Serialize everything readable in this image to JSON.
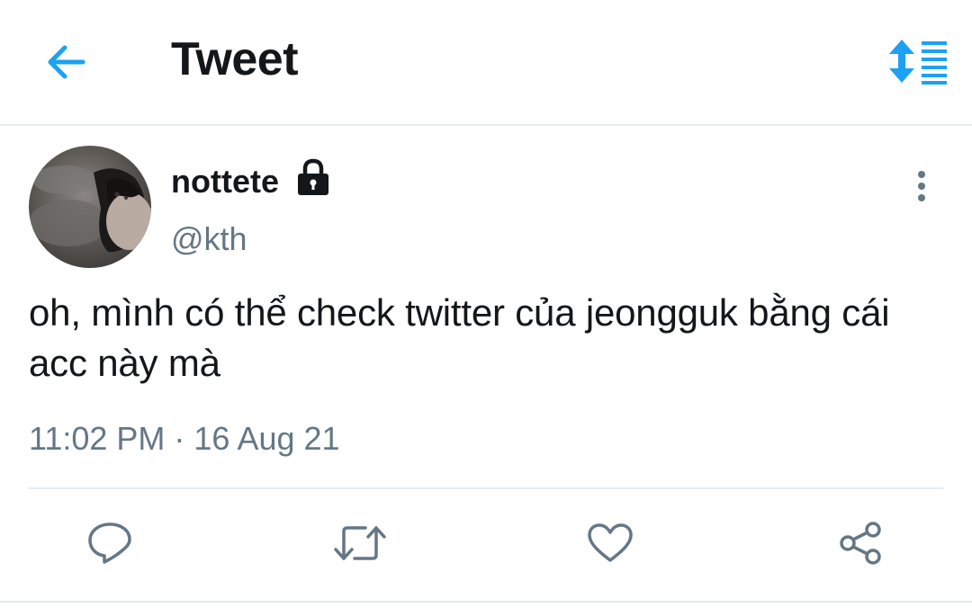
{
  "header": {
    "title": "Tweet",
    "back_icon": "arrow-left-icon",
    "sort_icon": "sort-lines-icon",
    "accent_color": "#1da1f2"
  },
  "tweet": {
    "display_name": "nottete",
    "protected_icon": "lock-icon",
    "handle": "@kth",
    "text": "oh, mình có thể check twitter của jeongguk bằng cái acc này mà",
    "timestamp": "11:02 PM · 16 Aug 21",
    "more_icon": "more-vertical-icon"
  },
  "actions": [
    {
      "name": "reply",
      "icon": "reply-icon"
    },
    {
      "name": "retweet",
      "icon": "retweet-icon"
    },
    {
      "name": "like",
      "icon": "heart-icon"
    },
    {
      "name": "share",
      "icon": "share-icon"
    }
  ],
  "colors": {
    "text_primary": "#14171a",
    "text_secondary": "#657786",
    "border": "#e6ecf0",
    "icon_gray": "#657786"
  }
}
